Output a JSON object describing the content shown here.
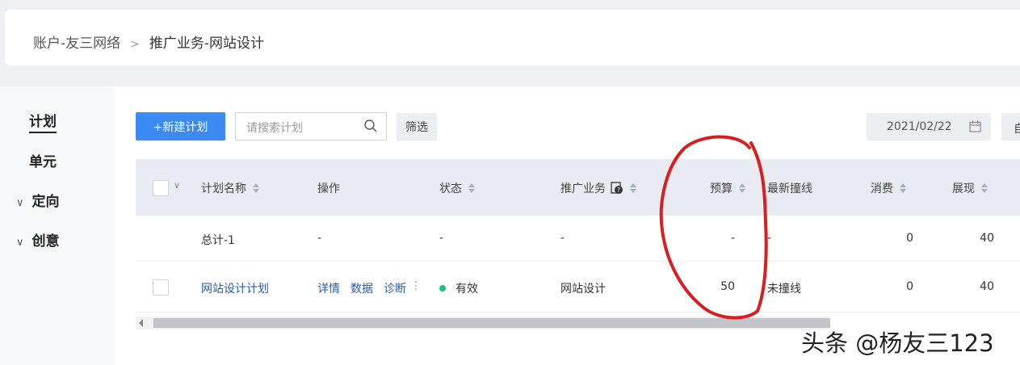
{
  "breadcrumb": {
    "account": "账户-友三网络",
    "separator": ">",
    "current": "推广业务-网站设计"
  },
  "leftnav": {
    "items": [
      {
        "label": "计划",
        "active": true
      },
      {
        "label": "单元"
      },
      {
        "label": "定向",
        "collapsible": true
      },
      {
        "label": "创意",
        "collapsible": true
      }
    ]
  },
  "toolbar": {
    "new_plan": "+新建计划",
    "search_placeholder": "请搜索计划",
    "filter": "筛选",
    "date": "2021/02/22",
    "custom_partial": "自"
  },
  "table": {
    "columns": [
      "计划名称",
      "操作",
      "状态",
      "推广业务",
      "预算",
      "最新撞线",
      "消费",
      "展现"
    ],
    "total_row": {
      "name": "总计-1",
      "op": "-",
      "status": "-",
      "business": "-",
      "budget": "-",
      "latest": "-",
      "spend": "0",
      "impressions": "40"
    },
    "rows": [
      {
        "name": "网站设计计划",
        "actions": [
          "详情",
          "数据",
          "诊断"
        ],
        "status": "有效",
        "business": "网站设计",
        "budget": "50",
        "latest": "未撞线",
        "spend": "0",
        "impressions": "40"
      }
    ]
  },
  "colors": {
    "primary": "#3c8bf5",
    "status_active": "#19c47a",
    "annotation": "#d81e1e"
  },
  "watermark": "头条 @杨友三123"
}
